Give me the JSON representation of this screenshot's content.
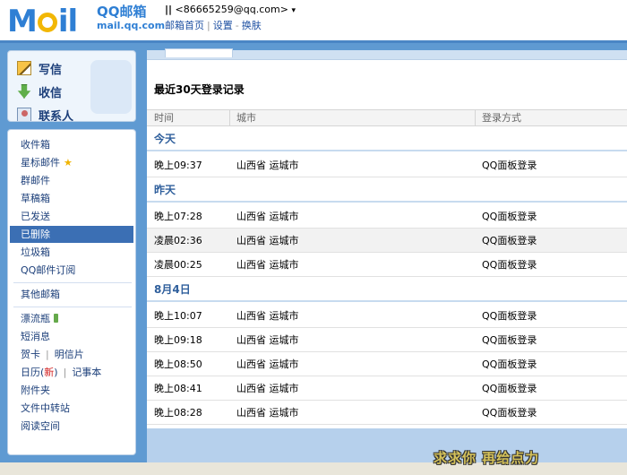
{
  "header": {
    "logo_text_left": "M",
    "logo_text_right": "il",
    "logo_cn": "QQ邮箱",
    "logo_en": "mail.qq.com",
    "account_pipes": "||",
    "account_email": "<86665259@qq.com>",
    "account_arrow": "▾",
    "nav": [
      "邮箱首页",
      "设置",
      "换肤"
    ],
    "nav_sep_1": "|",
    "nav_sep_2": "-"
  },
  "sidebar": {
    "quick": [
      {
        "label": "写信",
        "icon": "pencil-icon"
      },
      {
        "label": "收信",
        "icon": "inbox-download-icon"
      },
      {
        "label": "联系人",
        "icon": "contacts-icon"
      }
    ],
    "folders": {
      "inbox": "收件箱",
      "starred": "星标邮件",
      "group": "群邮件",
      "drafts": "草稿箱",
      "sent": "已发送",
      "deleted": "已删除",
      "spam": "垃圾箱",
      "subscriptions": "QQ邮件订阅",
      "other": "其他邮箱",
      "bottle": "漂流瓶",
      "sms": "短消息",
      "greeting_card": "贺卡",
      "postcard": "明信片",
      "calendar": "日历",
      "calendar_new_open": "(",
      "calendar_new": "新",
      "calendar_new_close": ")",
      "notes": "记事本",
      "attachments": "附件夹",
      "file_transfer": "文件中转站",
      "reading_space": "阅读空间",
      "pipe": "|"
    },
    "active_folder": "已删除"
  },
  "main": {
    "title": "最近30天登录记录",
    "columns": [
      "时间",
      "城市",
      "登录方式"
    ],
    "groups": [
      {
        "label": "今天",
        "rows": [
          {
            "time": "晚上09:37",
            "city": "山西省 运城市",
            "method": "QQ面板登录"
          }
        ]
      },
      {
        "label": "昨天",
        "rows": [
          {
            "time": "晚上07:28",
            "city": "山西省 运城市",
            "method": "QQ面板登录"
          },
          {
            "time": "凌晨02:36",
            "city": "山西省 运城市",
            "method": "QQ面板登录"
          },
          {
            "time": "凌晨00:25",
            "city": "山西省 运城市",
            "method": "QQ面板登录"
          }
        ]
      },
      {
        "label": "8月4日",
        "rows": [
          {
            "time": "晚上10:07",
            "city": "山西省 运城市",
            "method": "QQ面板登录"
          },
          {
            "time": "晚上09:18",
            "city": "山西省 运城市",
            "method": "QQ面板登录"
          },
          {
            "time": "晚上08:50",
            "city": "山西省 运城市",
            "method": "QQ面板登录"
          },
          {
            "time": "晚上08:41",
            "city": "山西省 运城市",
            "method": "QQ面板登录"
          },
          {
            "time": "晚上08:28",
            "city": "山西省 运城市",
            "method": "QQ面板登录"
          }
        ]
      }
    ]
  },
  "watermark": "求求你 再给点力",
  "colors": {
    "brand_blue": "#2f7fd4",
    "frame_blue": "#5f9ad2",
    "active_folder_bg": "#3b6fb4",
    "group_label": "#2f5f9c"
  }
}
